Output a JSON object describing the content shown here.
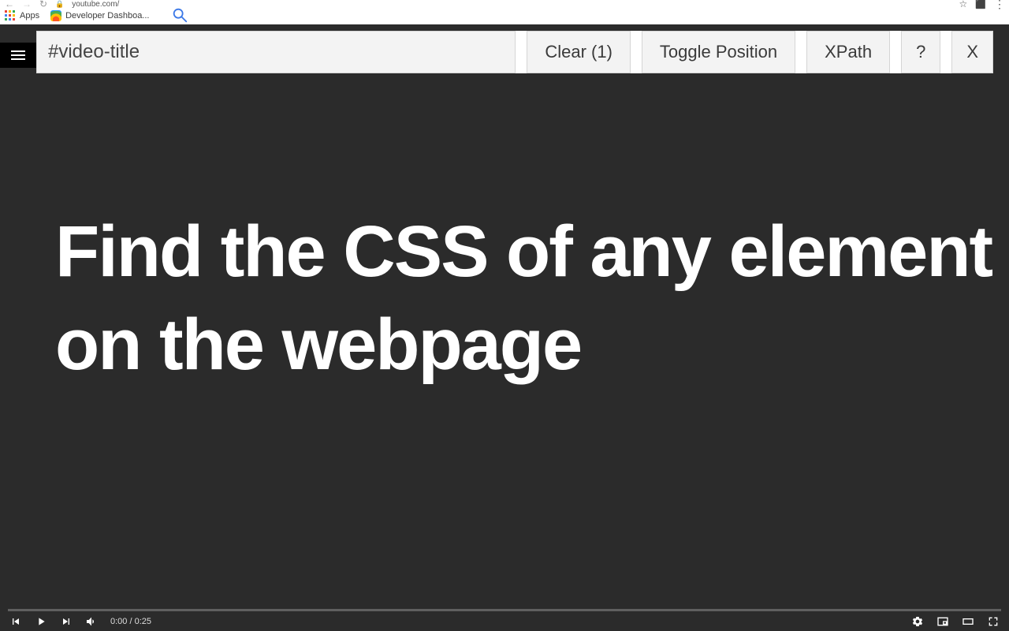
{
  "browser": {
    "url": "youtube.com/",
    "bookmarks": {
      "apps_label": "Apps",
      "item1": "Developer Dashboa..."
    }
  },
  "extension_bar": {
    "query_value": "#video-title",
    "clear_label": "Clear (1)",
    "toggle_label": "Toggle Position",
    "xpath_label": "XPath",
    "help_label": "?",
    "close_label": "X"
  },
  "hero": {
    "text": "Find the CSS of any element on the webpage"
  },
  "player": {
    "time": "0:00 / 0:25"
  }
}
